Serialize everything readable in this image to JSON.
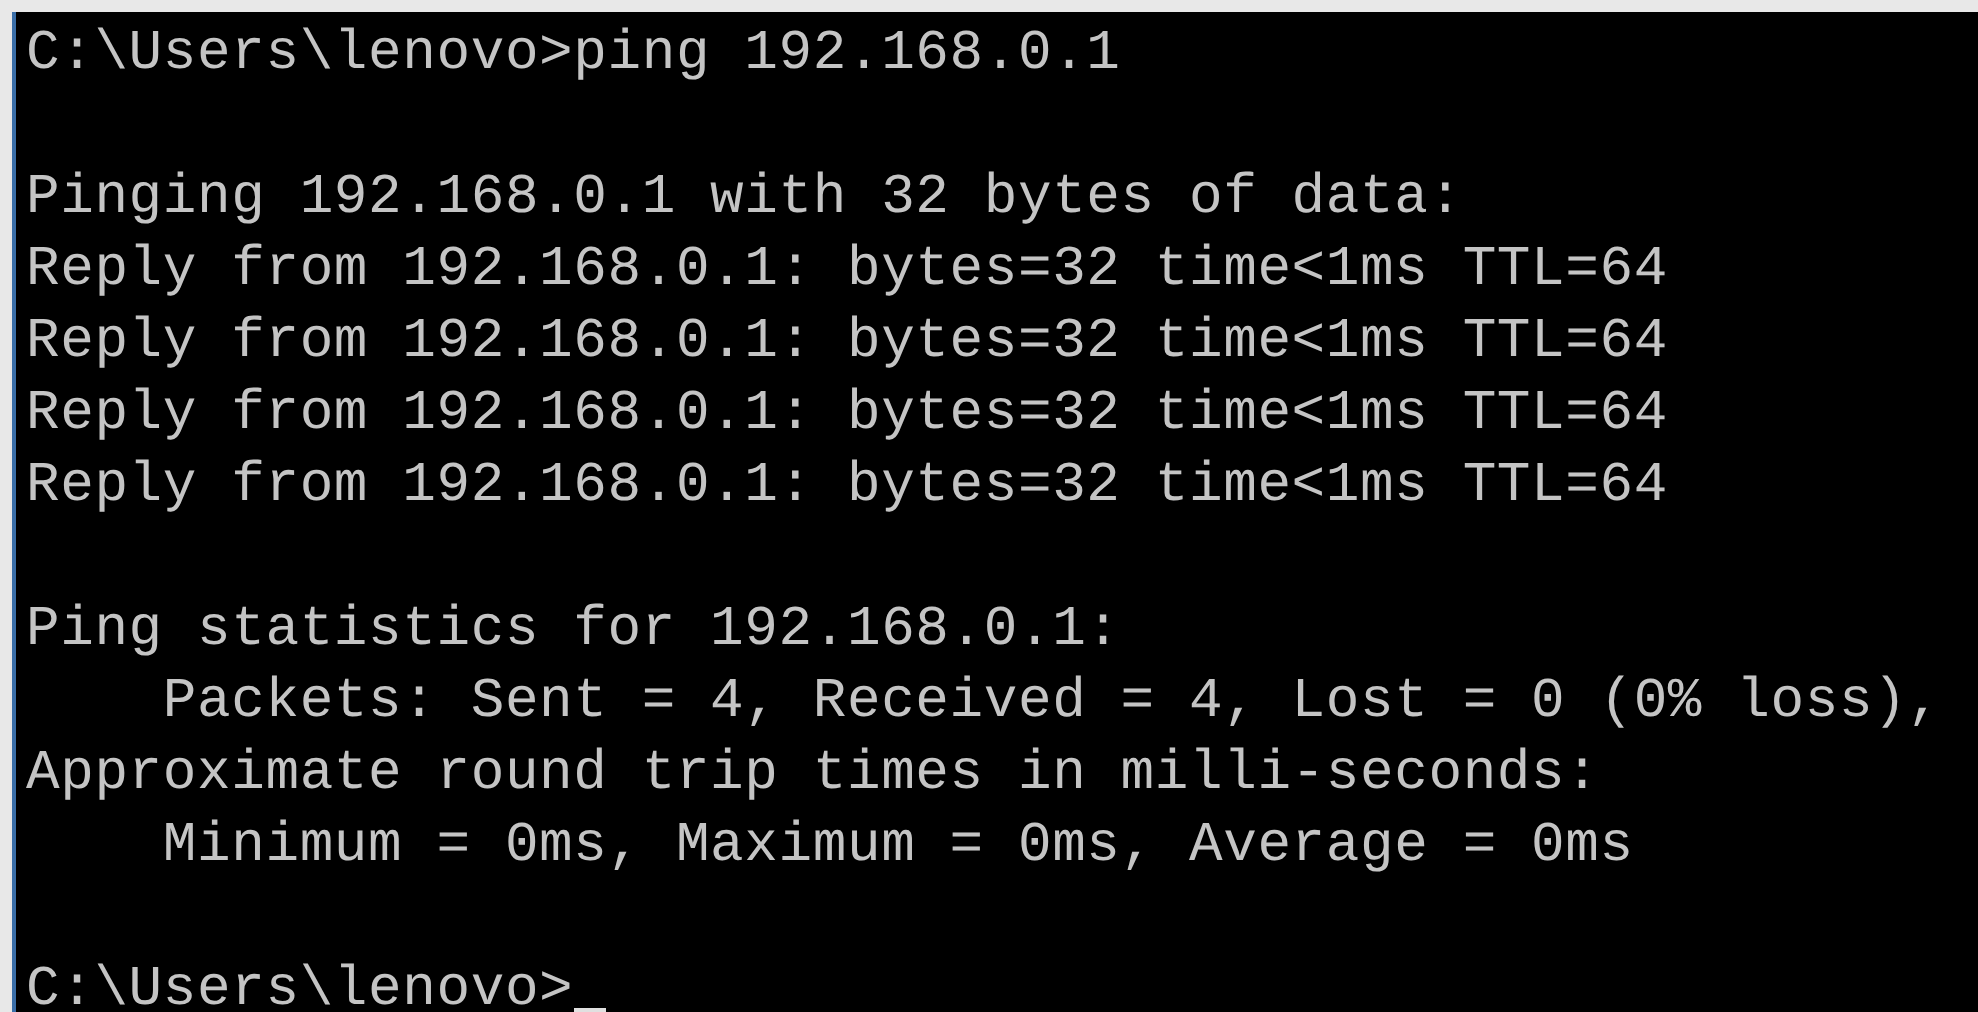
{
  "console": {
    "blocks": [
      [
        "C:\\Users\\lenovo>ping 192.168.0.1"
      ],
      [
        "Pinging 192.168.0.1 with 32 bytes of data:",
        "Reply from 192.168.0.1: bytes=32 time<1ms TTL=64",
        "Reply from 192.168.0.1: bytes=32 time<1ms TTL=64",
        "Reply from 192.168.0.1: bytes=32 time<1ms TTL=64",
        "Reply from 192.168.0.1: bytes=32 time<1ms TTL=64"
      ],
      [
        "Ping statistics for 192.168.0.1:",
        "    Packets: Sent = 4, Received = 4, Lost = 0 (0% loss),",
        "Approximate round trip times in milli-seconds:",
        "    Minimum = 0ms, Maximum = 0ms, Average = 0ms"
      ],
      [
        "C:\\Users\\lenovo>"
      ]
    ],
    "cursor_visible": true
  }
}
